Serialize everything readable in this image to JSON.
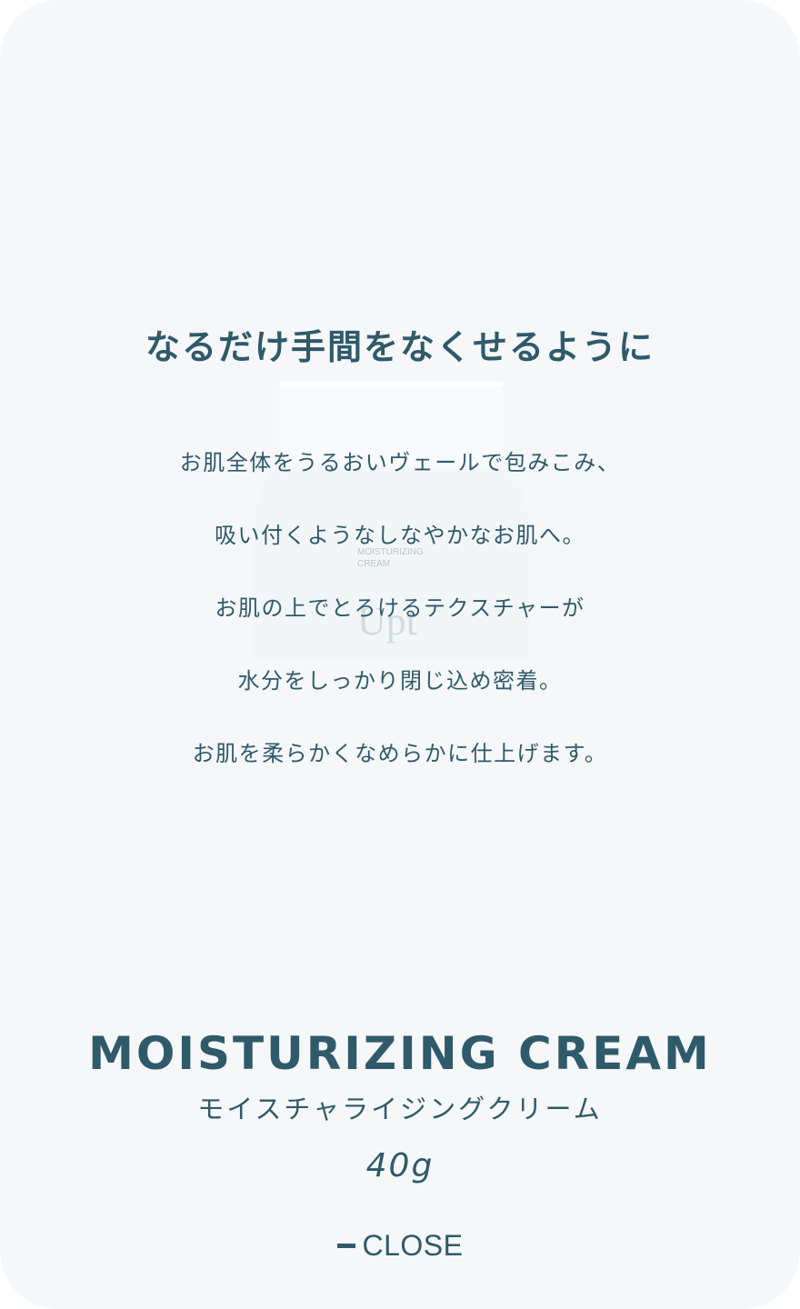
{
  "headline": "なるだけ手間をなくせるように",
  "description_lines": [
    "お肌全体をうるおいヴェールで包みこみ、",
    "吸い付くようなしなやかなお肌へ。",
    "お肌の上でとろけるテクスチャーが",
    "水分をしっかり閉じ込め密着。",
    "お肌を柔らかくなめらかに仕上げます。"
  ],
  "product_image": {
    "label_line1": "MOISTURIZING",
    "label_line2": "CREAM",
    "logo": "Upt"
  },
  "product": {
    "name": "MOISTURIZING CREAM",
    "kana": "モイスチャライジングクリーム",
    "size": "40g"
  },
  "close": {
    "label": "CLOSE",
    "icon": "minus-icon"
  },
  "colors": {
    "background": "#f5f7f8",
    "text": "#2f5a6a"
  }
}
